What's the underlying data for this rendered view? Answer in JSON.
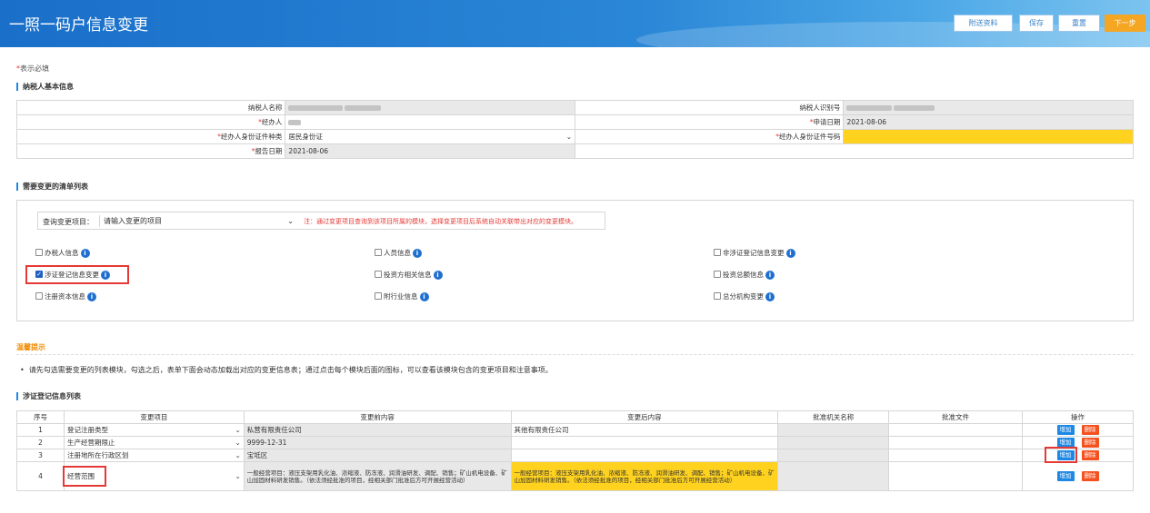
{
  "header": {
    "title": "一照一码户信息变更",
    "buttons": {
      "attach": "附送资料",
      "save": "保存",
      "reset": "重置",
      "next": "下一步"
    }
  },
  "required_note": {
    "star": "*",
    "text": "表示必填"
  },
  "basic_section": {
    "title": "纳税人基本信息",
    "fields": {
      "taxpayer_name_label": "纳税人名称",
      "taxpayer_id_label": "纳税人识别号",
      "agent_label": "经办人",
      "apply_date_label": "申请日期",
      "apply_date_value": "2021-08-06",
      "agent_id_type_label": "经办人身份证件种类",
      "agent_id_type_value": "居民身份证",
      "agent_id_no_label": "经办人身份证件号码",
      "report_date_label": "报告日期",
      "report_date_value": "2021-08-06"
    }
  },
  "change_section": {
    "title": "需要变更的清单列表",
    "query_label": "查询变更项目：",
    "query_placeholder": "请输入变更的项目",
    "query_tip": "注：通过变更项目查询到该项目所属的模块，选择变更项目后系统自动关联带出对应的变更模块。",
    "checkboxes": [
      {
        "label": "办税人信息",
        "checked": false
      },
      {
        "label": "人员信息",
        "checked": false
      },
      {
        "label": "非涉证登记信息变更",
        "checked": false
      },
      {
        "label": "涉证登记信息变更",
        "checked": true
      },
      {
        "label": "投资方相关信息",
        "checked": false
      },
      {
        "label": "投资总额信息",
        "checked": false
      },
      {
        "label": "注册资本信息",
        "checked": false
      },
      {
        "label": "附行业信息",
        "checked": false
      },
      {
        "label": "总分机构变更",
        "checked": false
      }
    ],
    "checkmark": "✓"
  },
  "tips": {
    "title": "温馨提示",
    "text": "请先勾选需要变更的列表模块，勾选之后，表单下面会动态加载出对应的变更信息表；通过点击每个模块后面的图标，可以查看该模块包含的变更项目和注意事项。"
  },
  "list_section": {
    "title": "涉证登记信息列表",
    "columns": [
      "序号",
      "变更项目",
      "变更前内容",
      "变更后内容",
      "批准机关名称",
      "批准文件",
      "操作"
    ],
    "add_label": "增加",
    "delete_label": "删除",
    "rows": [
      {
        "no": "1",
        "item": "登记注册类型",
        "before": "私营有限责任公司",
        "after": "其他有限责任公司"
      },
      {
        "no": "2",
        "item": "生产经营期限止",
        "before": "9999-12-31",
        "after": ""
      },
      {
        "no": "3",
        "item": "注册地所在行政区划",
        "before": "宝坻区",
        "after": ""
      },
      {
        "no": "4",
        "item": "经营范围",
        "before": "一般经营项目：液压支架用乳化油、浓缩液、防冻液、润滑油研发、调配、销售；矿山机电设备、矿山加固材料研发销售。（依法须经批准的项目，经相关部门批准后方可开展经营活动）",
        "after": "一般经营项目：液压支架用乳化油、浓缩液、防冻液、润滑油研发、调配、销售；矿山机电设备、矿山加固材料研发销售。（依法须经批准的项目，经相关部门批准后方可开展经营活动）"
      }
    ]
  },
  "icons": {
    "info": "i",
    "chevron": "⌄"
  }
}
